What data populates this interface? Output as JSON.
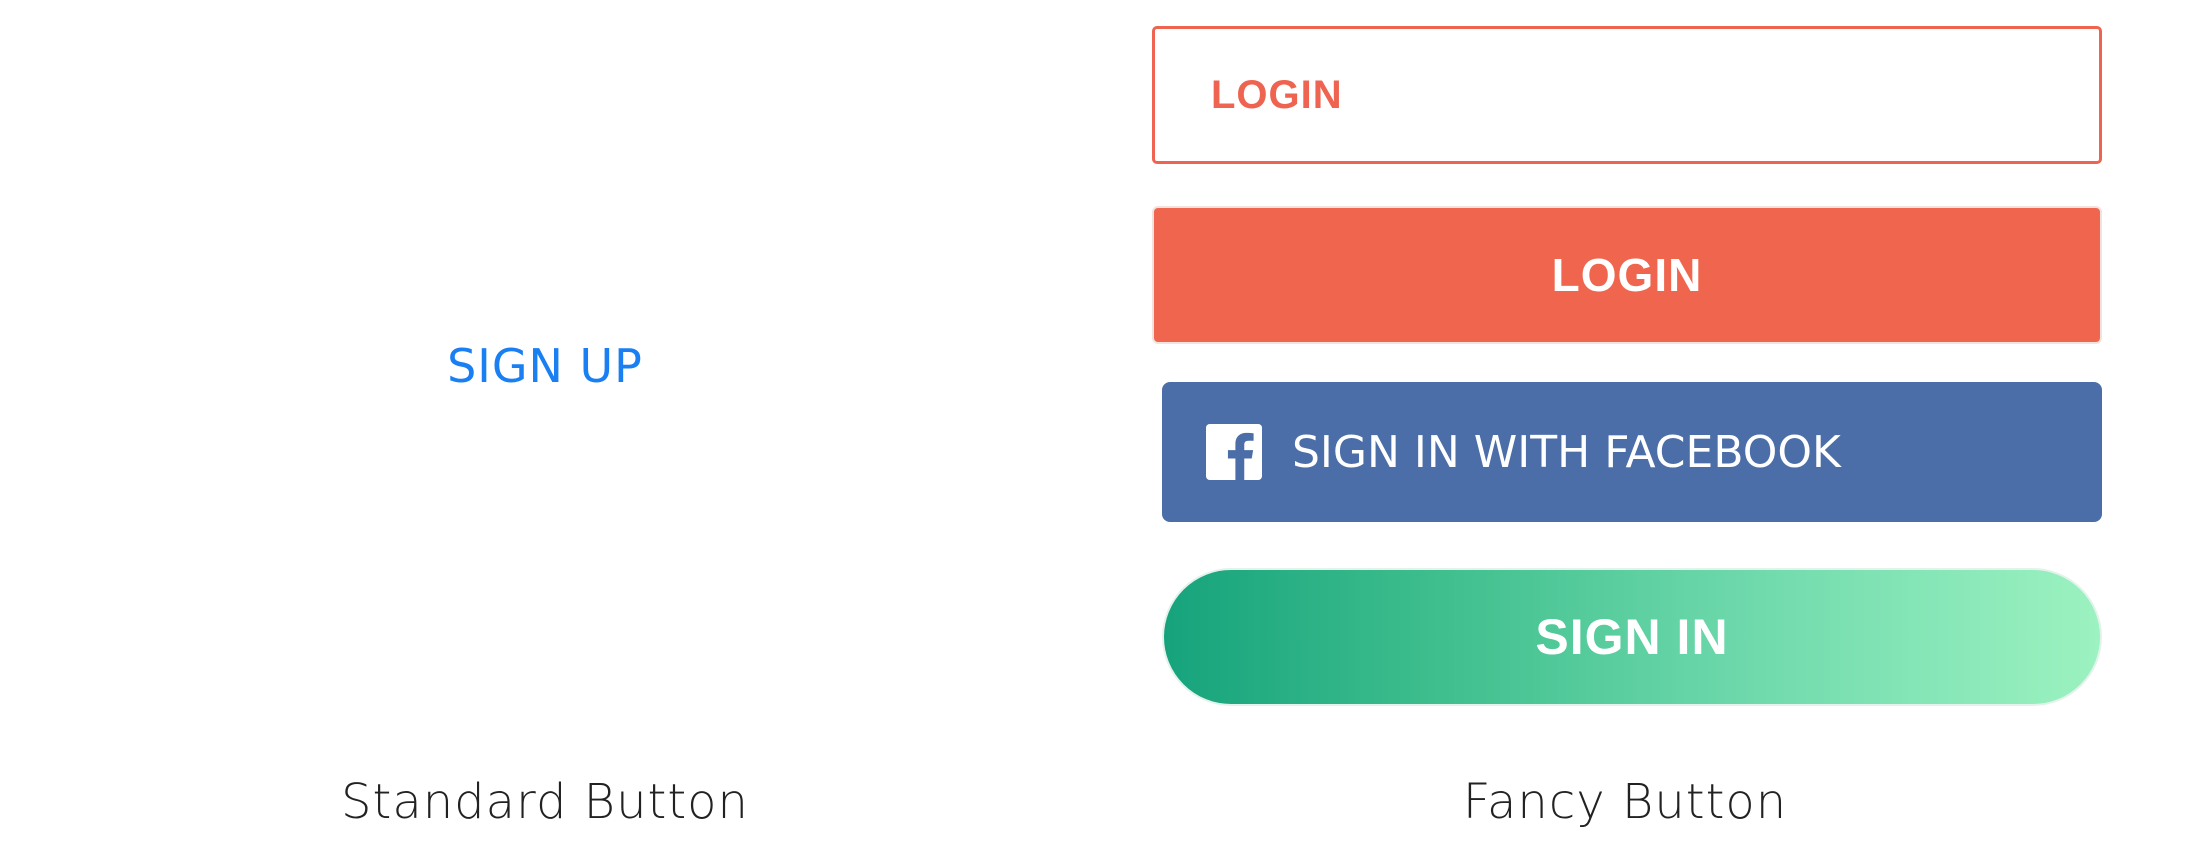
{
  "standard": {
    "button_label": "SIGN UP",
    "caption": "Standard Button"
  },
  "fancy": {
    "outline_button_label": "LOGIN",
    "solid_button_label": "LOGIN",
    "facebook_button_label": "SIGN IN WITH FACEBOOK",
    "facebook_icon": "facebook-logo-icon",
    "gradient_button_label": "SIGN IN",
    "caption": "Fancy Button"
  },
  "colors": {
    "standard_text": "#1a7ff2",
    "login_accent": "#ee6450",
    "facebook_blue": "#4b6ea8",
    "gradient_start": "#16a37c",
    "gradient_end": "#9cf2c0"
  }
}
